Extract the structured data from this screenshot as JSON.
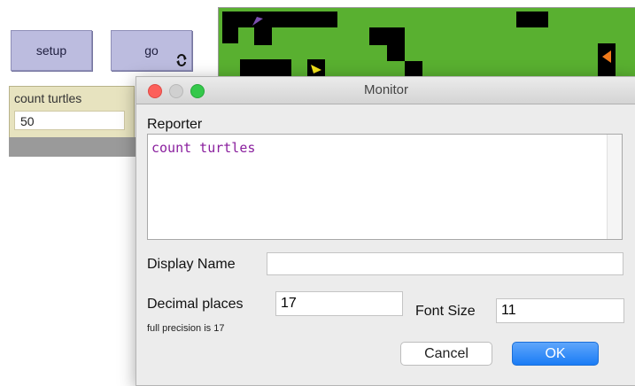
{
  "interface": {
    "setup_label": "setup",
    "go_label": "go",
    "monitor": {
      "label": "count turtles",
      "value": "50"
    }
  },
  "dialog": {
    "title": "Monitor",
    "reporter_label": "Reporter",
    "reporter_code": "count turtles",
    "display_name_label": "Display Name",
    "display_name_value": "",
    "decimal_places_label": "Decimal places",
    "decimal_places_value": "17",
    "precision_note": "full precision is 17",
    "font_size_label": "Font Size",
    "font_size_value": "11",
    "cancel_label": "Cancel",
    "ok_label": "OK"
  },
  "colors": {
    "patch_green": "#59b030",
    "reporter_text": "#8a1f9e",
    "ok_blue": "#1a7cf5"
  }
}
